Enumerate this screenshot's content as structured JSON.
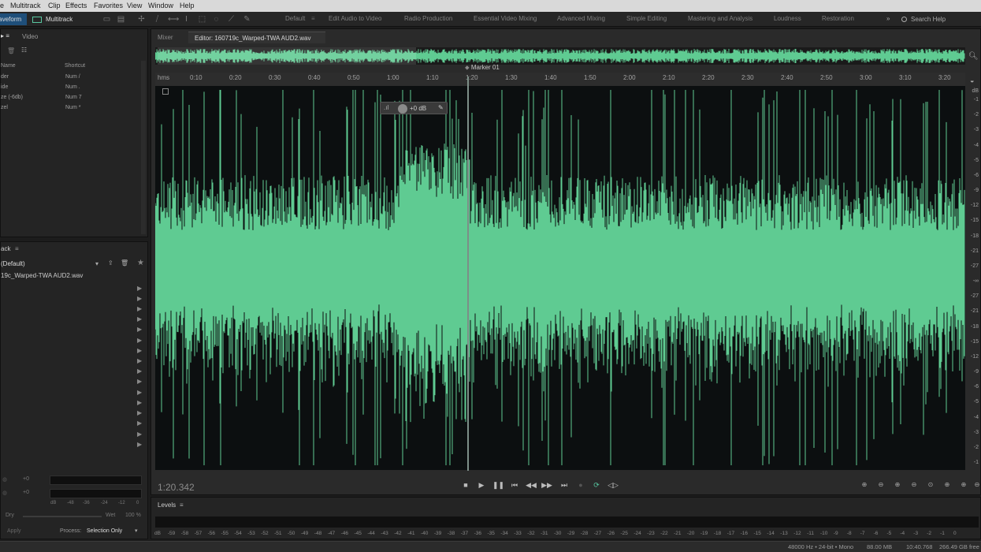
{
  "menu": [
    "Multitrack",
    "Clip",
    "Effects",
    "Favorites",
    "View",
    "Window",
    "Help"
  ],
  "toolbar": {
    "mode_waveform": "Waveform",
    "mode_multitrack": "Multitrack",
    "workspaces": [
      "Default",
      "Edit Audio to Video",
      "Radio Production",
      "Essential Video Mixing",
      "Advanced Mixing",
      "Simple Editing",
      "Mastering and Analysis",
      "Loudness",
      "Restoration"
    ],
    "search_help": "Search Help"
  },
  "left_top": {
    "tab": "Video",
    "col_name": "Name",
    "col_shortcut": "Shortcut",
    "rows": [
      {
        "name": "der",
        "shortcut": "Num /"
      },
      {
        "name": "ide",
        "shortcut": "Num ."
      },
      {
        "name": "ze (-6db)",
        "shortcut": "Num 7"
      },
      {
        "name": "zel",
        "shortcut": "Num *"
      }
    ]
  },
  "left_bottom": {
    "title": "ack",
    "preset": "(Default)",
    "file": "19c_Warped-TWA AUD2.wav",
    "meter_vals": [
      "+0",
      "+0"
    ],
    "meter_ticks": [
      "dB",
      "-48",
      "-36",
      "-24",
      "-12",
      "0"
    ],
    "dry": "Dry",
    "wet": "Wet",
    "wet_pct": "100 %",
    "apply": "Apply",
    "process_label": "Process:",
    "process_value": "Selection Only"
  },
  "editor": {
    "tab_mixer": "Mixer",
    "tab_active": "Editor: 160719c_Warped-TWA AUD2.wav *",
    "marker": "Marker 01",
    "ruler_unit": "hms",
    "ruler": [
      "0:10",
      "0:20",
      "0:30",
      "0:40",
      "0:50",
      "1:00",
      "1:10",
      "1:20",
      "1:30",
      "1:40",
      "1:50",
      "2:00",
      "2:10",
      "2:20",
      "2:30",
      "2:40",
      "2:50",
      "3:00",
      "3:10",
      "3:20"
    ],
    "db_unit": "dB",
    "db_scale": [
      "-1",
      "-2",
      "-3",
      "-4",
      "-5",
      "-6",
      "-9",
      "-12",
      "-15",
      "-18",
      "-21",
      "-27",
      "-∞",
      "-27",
      "-21",
      "-18",
      "-15",
      "-12",
      "-9",
      "-6",
      "-5",
      "-4",
      "-3",
      "-2",
      "-1"
    ],
    "hud_value": "+0 dB",
    "time": "1:20.342"
  },
  "levels": {
    "title": "Levels",
    "ticks": [
      "dB",
      "-59",
      "-58",
      "-57",
      "-56",
      "-55",
      "-54",
      "-53",
      "-52",
      "-51",
      "-50",
      "-49",
      "-48",
      "-47",
      "-46",
      "-45",
      "-44",
      "-43",
      "-42",
      "-41",
      "-40",
      "-39",
      "-38",
      "-37",
      "-36",
      "-35",
      "-34",
      "-33",
      "-32",
      "-31",
      "-30",
      "-29",
      "-28",
      "-27",
      "-26",
      "-25",
      "-24",
      "-23",
      "-22",
      "-21",
      "-20",
      "-19",
      "-18",
      "-17",
      "-16",
      "-15",
      "-14",
      "-13",
      "-12",
      "-11",
      "-10",
      "-9",
      "-8",
      "-7",
      "-6",
      "-5",
      "-4",
      "-3",
      "-2",
      "-1",
      "0"
    ]
  },
  "status": {
    "format": "48000 Hz • 24-bit • Mono",
    "size": "88.00 MB",
    "duration": "10:40.768",
    "free": "266.49 GB free"
  },
  "colors": {
    "waveform": "#5fcb92",
    "accent": "#1f4f7a"
  }
}
